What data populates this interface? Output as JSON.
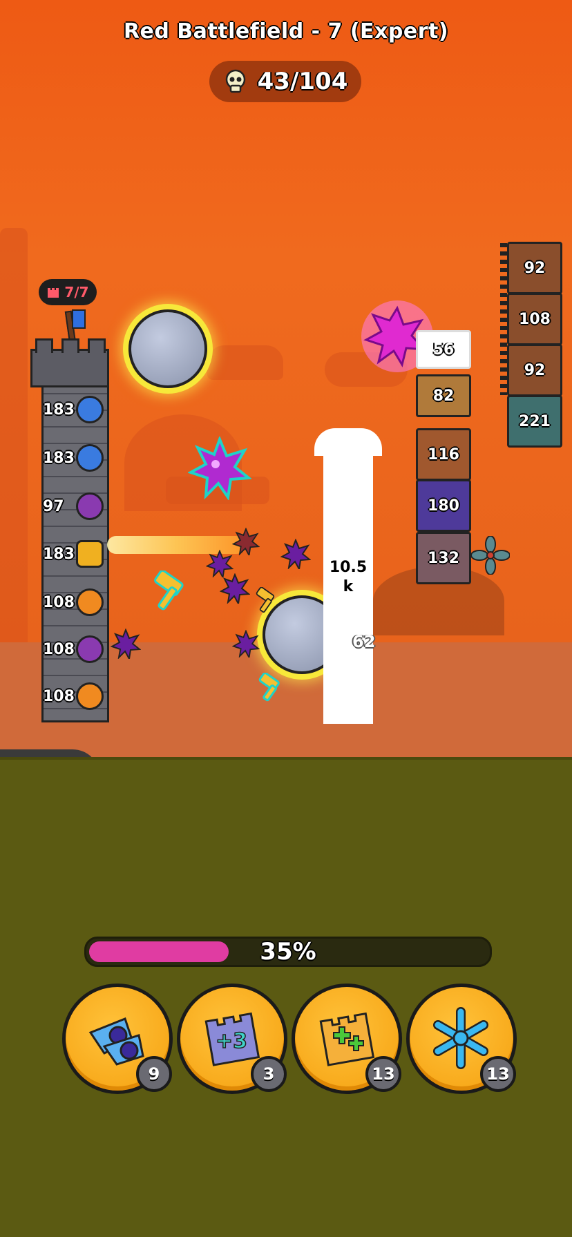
{
  "header": {
    "title": "Red Battlefield - 7 (Expert)",
    "kill_counter": "43/104",
    "kill_icon": "skull-icon"
  },
  "tower": {
    "capacity": "7/7",
    "capacity_icon": "tower-icon",
    "slots": [
      {
        "value": "183",
        "unit": "blue-bomb"
      },
      {
        "value": "183",
        "unit": "blue-bomb"
      },
      {
        "value": "97",
        "unit": "purple-bomb"
      },
      {
        "value": "183",
        "unit": "cannon"
      },
      {
        "value": "108",
        "unit": "orange-hammer"
      },
      {
        "value": "108",
        "unit": "purple-bomb"
      },
      {
        "value": "108",
        "unit": "orange-hammer"
      }
    ]
  },
  "enemies": {
    "center_stack": [
      "56",
      "82",
      "116",
      "180",
      "132"
    ],
    "right_stack": [
      "92",
      "108",
      "92",
      "221"
    ]
  },
  "battle": {
    "bone_label_line1": "10.5",
    "bone_label_line2": "k",
    "damage_number": "62"
  },
  "progress": {
    "percent_label": "35%",
    "value": 0.35,
    "color": "#e03ca2"
  },
  "powerups": [
    {
      "name": "double-shot",
      "icon": "twin-orbs-icon",
      "count": "9"
    },
    {
      "name": "plus-three-wall",
      "icon": "plus-three-icon",
      "count": "3"
    },
    {
      "name": "heal-wall",
      "icon": "plus-cross-icon",
      "count": "13"
    },
    {
      "name": "freeze",
      "icon": "snowflake-icon",
      "count": "13"
    }
  ],
  "colors": {
    "sky": "#ee5a14",
    "grass": "#5b5a12",
    "button": "#f5a00f"
  }
}
